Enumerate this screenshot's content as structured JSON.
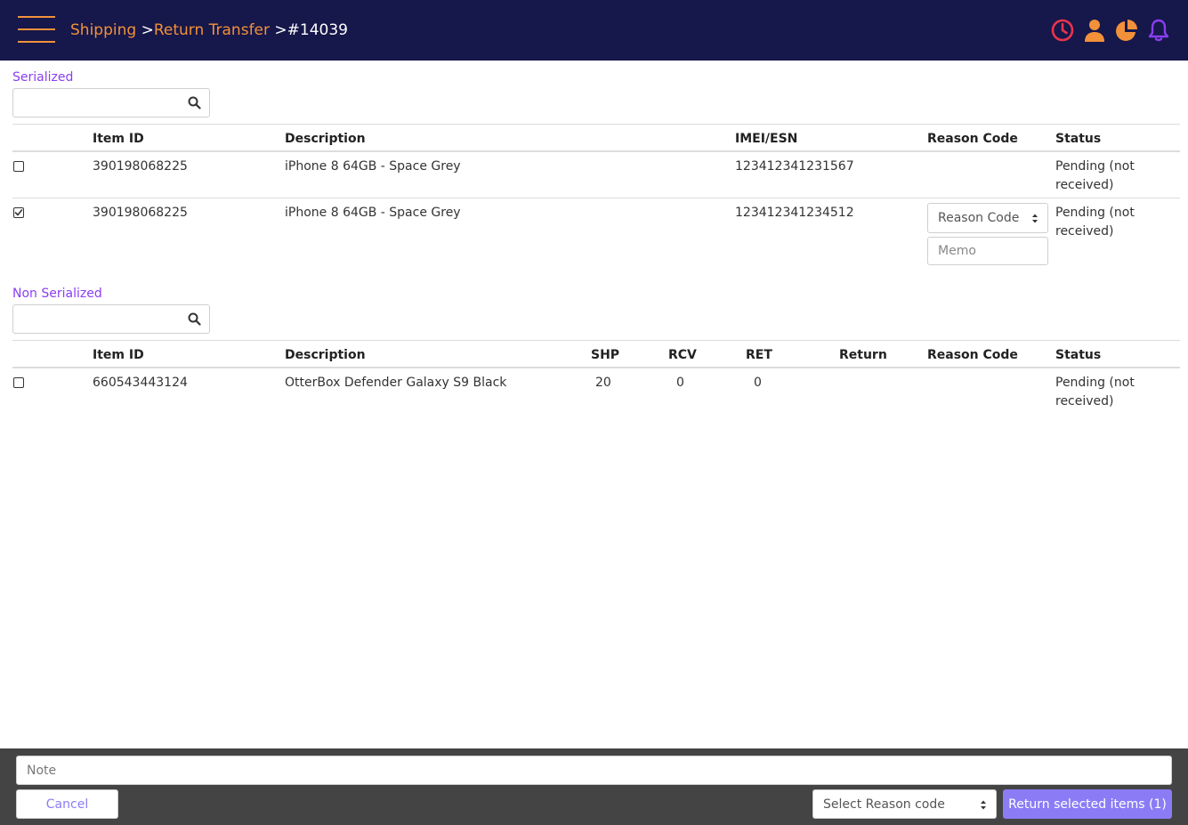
{
  "header": {
    "breadcrumb": {
      "items": [
        "Shipping",
        "Return Transfer"
      ],
      "separator": ">",
      "current": "#14039"
    },
    "icons": [
      "history-icon",
      "user-icon",
      "pie-chart-icon",
      "bell-icon"
    ],
    "colors": {
      "background": "#16174a",
      "accent": "#f2913a",
      "history": "#e8344e",
      "bell": "#8a3ef2"
    }
  },
  "serialized": {
    "label": "Serialized",
    "search": {
      "value": "",
      "placeholder": ""
    },
    "columns": [
      "Item ID",
      "Description",
      "IMEI/ESN",
      "Reason Code",
      "Status"
    ],
    "rows": [
      {
        "checked": false,
        "item_id": "390198068225",
        "description": "iPhone 8 64GB - Space Grey",
        "imei": "123412341231567",
        "reason_code": "",
        "status": "Pending (not received)"
      },
      {
        "checked": true,
        "item_id": "390198068225",
        "description": "iPhone 8 64GB - Space Grey",
        "imei": "123412341234512",
        "reason_code_select": "Reason Code",
        "memo_placeholder": "Memo",
        "status": "Pending (not received)"
      }
    ]
  },
  "non_serialized": {
    "label": "Non Serialized",
    "search": {
      "value": "",
      "placeholder": ""
    },
    "columns": [
      "Item ID",
      "Description",
      "SHP",
      "RCV",
      "RET",
      "Return",
      "Reason Code",
      "Status"
    ],
    "rows": [
      {
        "checked": false,
        "item_id": "660543443124",
        "description": "OtterBox Defender Galaxy S9 Black",
        "shp": "20",
        "rcv": "0",
        "ret": "0",
        "return": "",
        "reason_code": "",
        "status": "Pending (not received)"
      }
    ]
  },
  "footer": {
    "note_placeholder": "Note",
    "cancel_label": "Cancel",
    "reason_select": "Select Reason code",
    "return_label": "Return selected items (1)",
    "colors": {
      "background": "#444444",
      "primary": "#8b7cf6"
    }
  }
}
